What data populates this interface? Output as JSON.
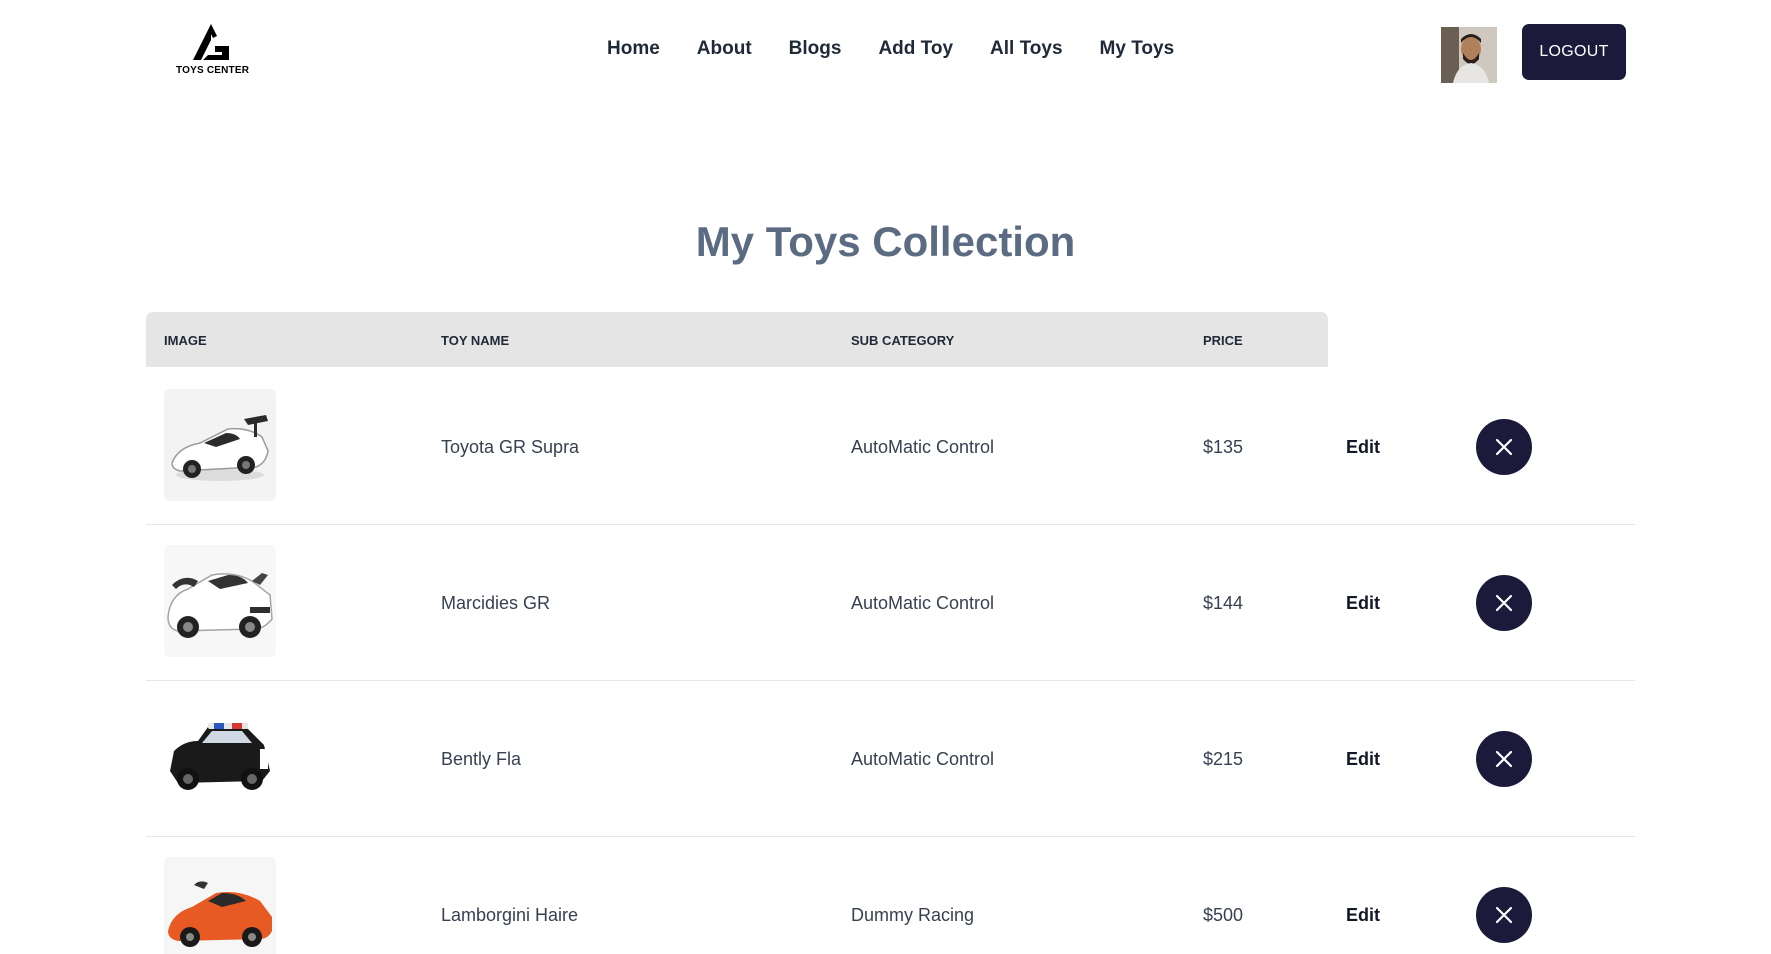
{
  "brand": {
    "logo_text": "TOYS CENTER"
  },
  "nav": {
    "items": [
      {
        "label": "Home"
      },
      {
        "label": "About"
      },
      {
        "label": "Blogs"
      },
      {
        "label": "Add Toy"
      },
      {
        "label": "All Toys"
      },
      {
        "label": "My Toys"
      }
    ]
  },
  "header": {
    "logout_label": "LOGOUT"
  },
  "page": {
    "title": "My Toys Collection"
  },
  "table": {
    "columns": [
      "IMAGE",
      "TOY NAME",
      "SUB CATEGORY",
      "PRICE"
    ],
    "edit_label": "Edit",
    "rows": [
      {
        "name": "Toyota GR Supra",
        "sub_category": "AutoMatic Control",
        "price": "$135"
      },
      {
        "name": "Marcidies GR",
        "sub_category": "AutoMatic Control",
        "price": "$144"
      },
      {
        "name": "Bently Fla",
        "sub_category": "AutoMatic Control",
        "price": "$215"
      },
      {
        "name": "Lamborgini Haire",
        "sub_category": "Dummy Racing",
        "price": "$500"
      }
    ]
  },
  "colors": {
    "primary_dark": "#1b1a3b",
    "title": "#5a6b82",
    "table_header_bg": "#e5e5e5"
  },
  "icons": {
    "logo": "toys-center-logo-icon",
    "delete": "close-icon"
  }
}
